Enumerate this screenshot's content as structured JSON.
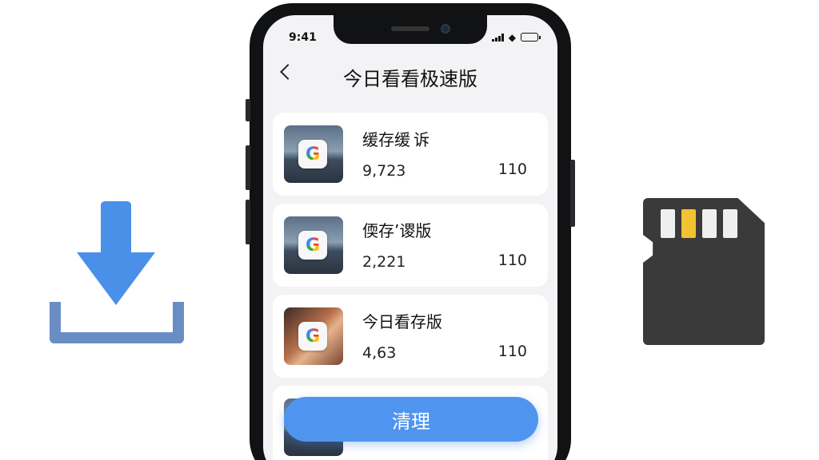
{
  "status_bar": {
    "time": "9:41"
  },
  "header": {
    "title": "今日看看极速版"
  },
  "items": [
    {
      "name": "缓存缓 诉",
      "count": "9,723",
      "size": "110"
    },
    {
      "name": "偄存’谡版",
      "count": "2,221",
      "size": "110"
    },
    {
      "name": "今日看存版",
      "count": "4,63 ",
      "size": "110"
    }
  ],
  "clean_button": {
    "label": "清理"
  },
  "icons": {
    "back": "chevron-left-icon",
    "app": "google-g-icon",
    "download": "download-icon",
    "storage": "sd-card-icon"
  },
  "colors": {
    "accent": "#4f95f0",
    "download_arrow": "#4a90e8",
    "download_tray": "#6a8dc4",
    "sd_card": "#3a3a3a",
    "sd_pin_highlight": "#f2c230"
  }
}
